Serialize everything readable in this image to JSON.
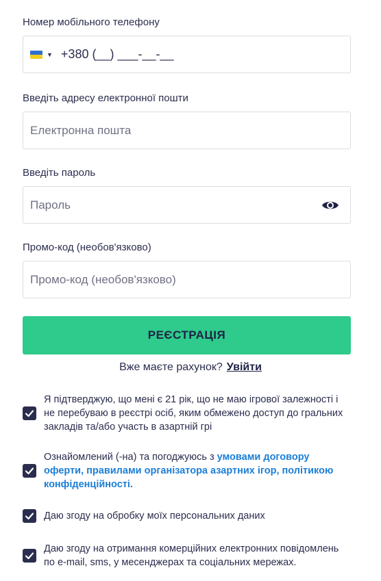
{
  "phone": {
    "label": "Номер мобільного телефону",
    "value": "+380 (__) ___-__-__"
  },
  "email": {
    "label": "Введіть адресу електронної пошти",
    "placeholder": "Електронна пошта"
  },
  "password": {
    "label": "Введіть пароль",
    "placeholder": "Пароль"
  },
  "promo": {
    "label": "Промо-код (необов'язково)",
    "placeholder": "Промо-код (необов'язково)"
  },
  "register_button": "РЕЄСТРАЦІЯ",
  "login": {
    "question": "Вже маєте рахунок?",
    "link": "Увійти"
  },
  "checkboxes": {
    "age": "Я підтверджую, що мені є 21 рік, що не маю ігрової залежності і не перебуваю в реєстрі осіб, яким обмежено доступ до гральних закладів та/або участь в азартній грі",
    "terms_prefix": "Ознайомлений (-на) та погоджуюсь з ",
    "terms_link1": "умовами договору оферти",
    "terms_sep1": ", ",
    "terms_link2": "правилами організатора азартних ігор",
    "terms_sep2": ", ",
    "terms_link3": "політикою конфіденційності",
    "terms_suffix": ".",
    "personal_data": "Даю згоду на обробку моїх персональних даних",
    "marketing": "Даю згоду на отримання комерційних електронних повідомлень по e-mail, sms, у месенджерах та соціальних мережах."
  },
  "colors": {
    "accent": "#2ecb8c",
    "text": "#2b2d4e",
    "link": "#1c7ed6"
  },
  "icons": {
    "flag": "ukraine-flag-icon",
    "chevron": "chevron-down-icon",
    "eye": "eye-icon",
    "check": "checkmark-icon"
  }
}
